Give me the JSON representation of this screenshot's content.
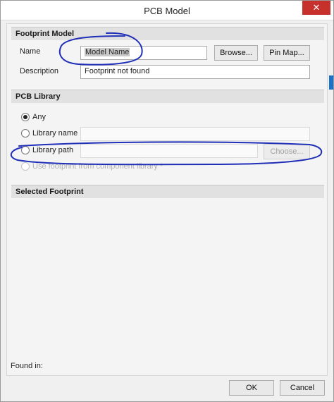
{
  "window": {
    "title": "PCB Model",
    "close_glyph": "✕"
  },
  "footprint_model": {
    "header": "Footprint Model",
    "name_label": "Name",
    "name_value": "Model Name",
    "browse_label": "Browse...",
    "pinmap_label": "Pin Map...",
    "description_label": "Description",
    "description_value": "Footprint not found"
  },
  "pcb_library": {
    "header": "PCB Library",
    "options": [
      {
        "label": "Any",
        "checked": true,
        "enabled": true
      },
      {
        "label": "Library name",
        "checked": false,
        "enabled": true
      },
      {
        "label": "Library path",
        "checked": false,
        "enabled": true
      },
      {
        "label": "Use footprint from component library *",
        "checked": false,
        "enabled": false
      }
    ],
    "choose_label": "Choose..."
  },
  "selected_footprint": {
    "header": "Selected Footprint"
  },
  "found_in_label": "Found in:",
  "buttons": {
    "ok": "OK",
    "cancel": "Cancel"
  },
  "colors": {
    "annotation_ink": "#1f2fb8",
    "close_button": "#c7312b",
    "accent_strip": "#1a73c9"
  }
}
